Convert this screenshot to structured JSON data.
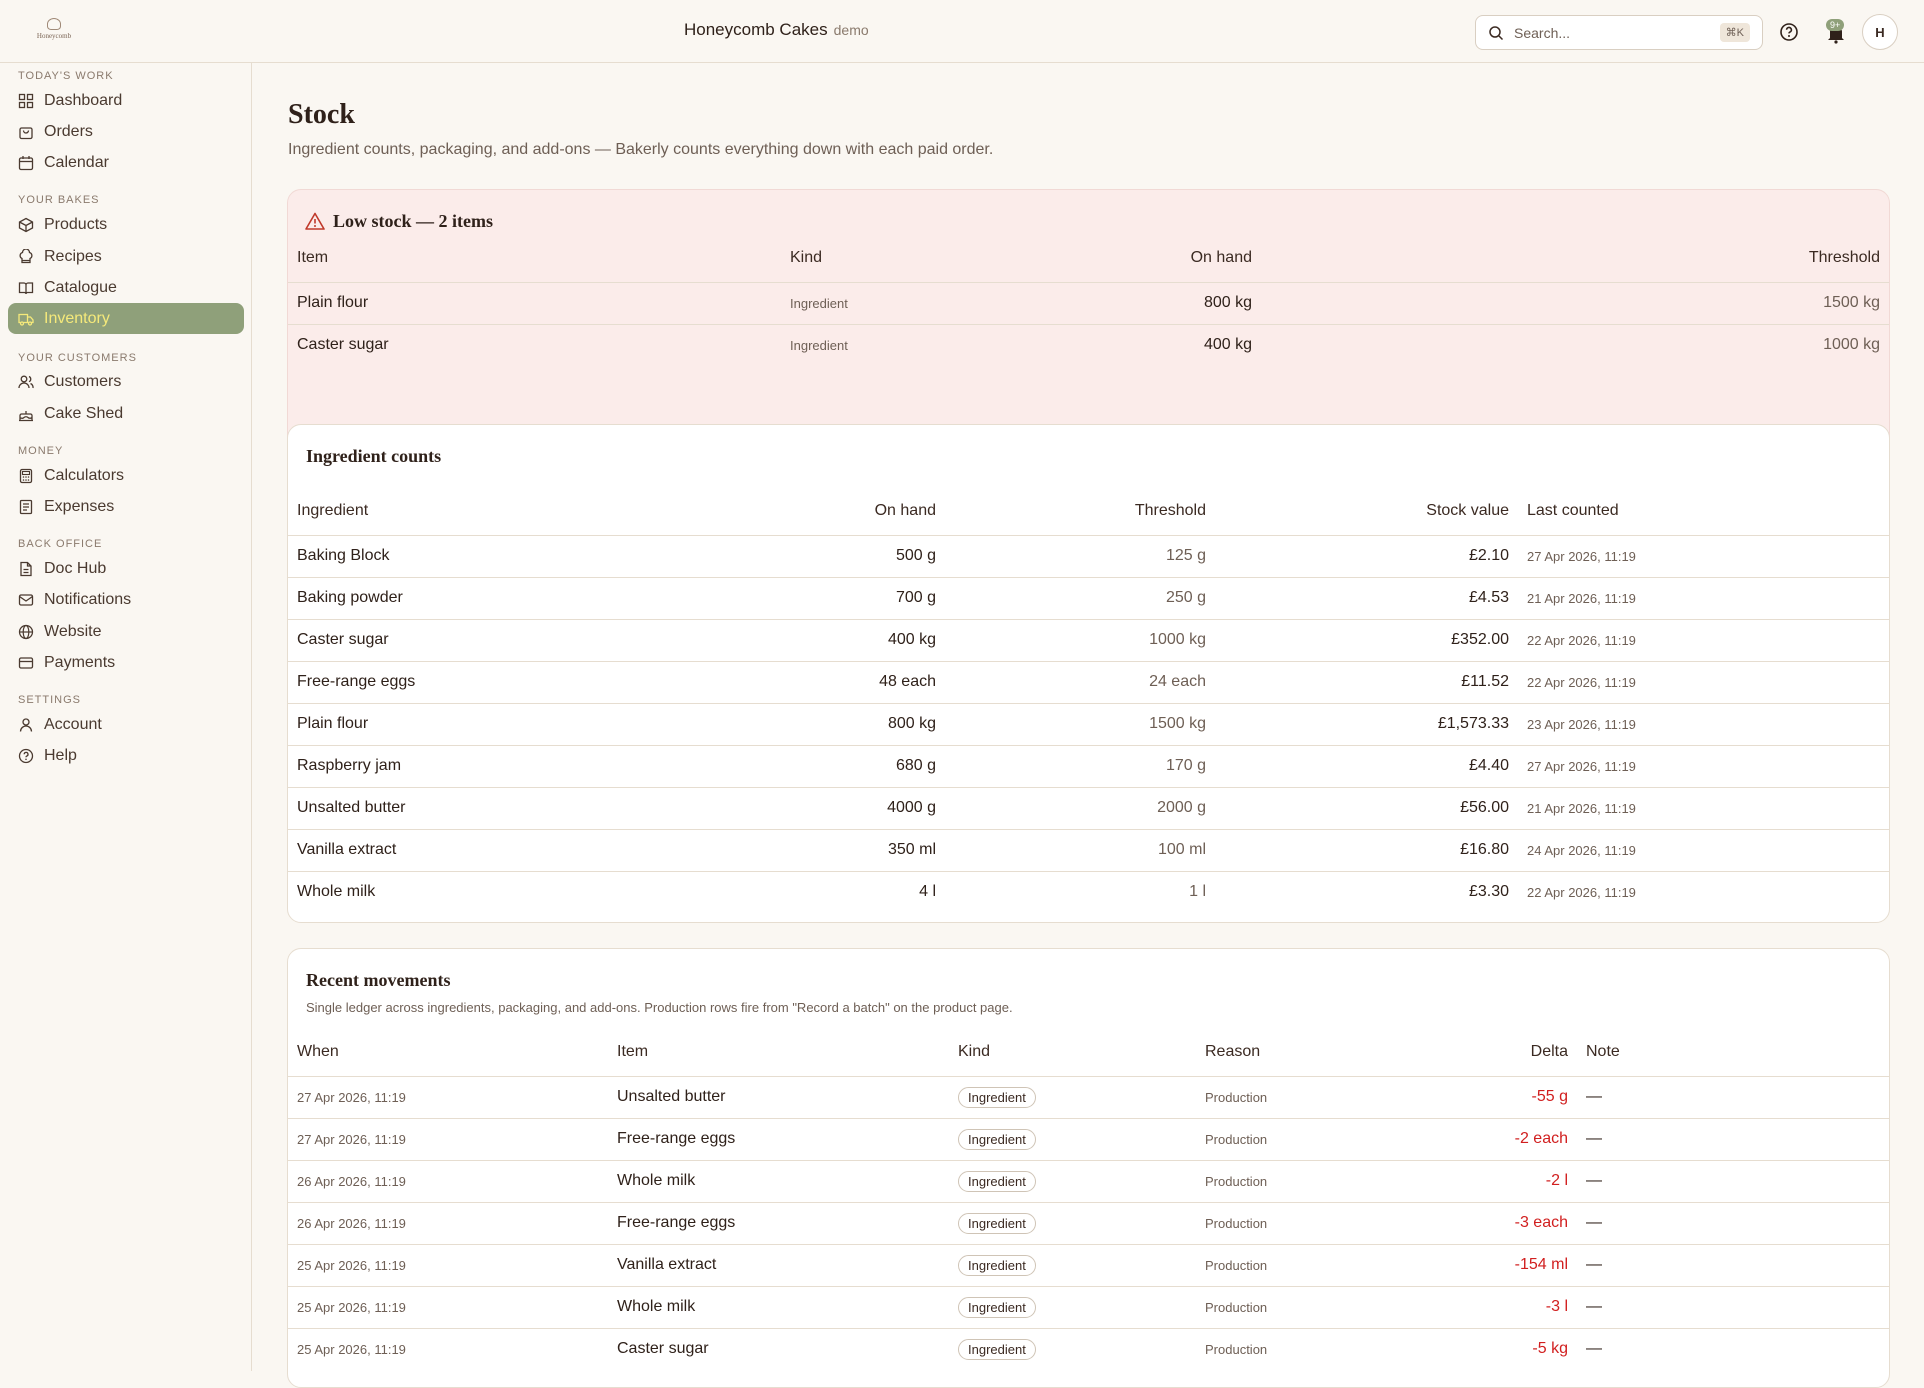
{
  "app": {
    "brand": "Honeycomb Cakes",
    "env": "demo",
    "logo_text": "Honeycomb"
  },
  "topbar": {
    "search_placeholder": "Search...",
    "search_shortcut": "⌘K",
    "notif_badge": "9+",
    "avatar_initial": "H"
  },
  "sidebar": {
    "sections": [
      {
        "label": "TODAY'S WORK",
        "items": [
          {
            "label": "Dashboard",
            "icon": "grid-icon"
          },
          {
            "label": "Orders",
            "icon": "bag-icon"
          },
          {
            "label": "Calendar",
            "icon": "calendar-icon"
          }
        ]
      },
      {
        "label": "YOUR BAKES",
        "items": [
          {
            "label": "Products",
            "icon": "box-icon"
          },
          {
            "label": "Recipes",
            "icon": "chef-hat-icon"
          },
          {
            "label": "Catalogue",
            "icon": "book-icon"
          },
          {
            "label": "Inventory",
            "icon": "truck-icon",
            "active": true
          }
        ]
      },
      {
        "label": "YOUR CUSTOMERS",
        "items": [
          {
            "label": "Customers",
            "icon": "users-icon"
          },
          {
            "label": "Cake Shed",
            "icon": "cake-icon"
          }
        ]
      },
      {
        "label": "MONEY",
        "items": [
          {
            "label": "Calculators",
            "icon": "calculator-icon"
          },
          {
            "label": "Expenses",
            "icon": "receipt-icon"
          }
        ]
      },
      {
        "label": "BACK OFFICE",
        "items": [
          {
            "label": "Doc Hub",
            "icon": "document-icon"
          },
          {
            "label": "Notifications",
            "icon": "mail-icon"
          },
          {
            "label": "Website",
            "icon": "globe-icon"
          },
          {
            "label": "Payments",
            "icon": "card-icon"
          }
        ]
      },
      {
        "label": "SETTINGS",
        "items": [
          {
            "label": "Account",
            "icon": "user-icon"
          },
          {
            "label": "Help",
            "icon": "help-icon"
          }
        ]
      }
    ]
  },
  "page": {
    "title": "Stock",
    "subtitle": "Ingredient counts, packaging, and add-ons — Bakerly counts everything down with each paid order."
  },
  "low_stock": {
    "title": "Low stock — 2 items",
    "columns": [
      "Item",
      "Kind",
      "On hand",
      "Threshold"
    ],
    "rows": [
      {
        "item": "Plain flour",
        "kind": "Ingredient",
        "on_hand": "800 kg",
        "threshold": "1500 kg"
      },
      {
        "item": "Caster sugar",
        "kind": "Ingredient",
        "on_hand": "400 kg",
        "threshold": "1000 kg"
      }
    ]
  },
  "ingredients": {
    "title": "Ingredient counts",
    "columns": [
      "Ingredient",
      "On hand",
      "Threshold",
      "Stock value",
      "Last counted"
    ],
    "rows": [
      {
        "name": "Baking Block",
        "on_hand": "500 g",
        "threshold": "125 g",
        "value": "£2.10",
        "last": "27 Apr 2026, 11:19"
      },
      {
        "name": "Baking powder",
        "on_hand": "700 g",
        "threshold": "250 g",
        "value": "£4.53",
        "last": "21 Apr 2026, 11:19"
      },
      {
        "name": "Caster sugar",
        "on_hand": "400 kg",
        "threshold": "1000 kg",
        "value": "£352.00",
        "last": "22 Apr 2026, 11:19"
      },
      {
        "name": "Free-range eggs",
        "on_hand": "48 each",
        "threshold": "24 each",
        "value": "£11.52",
        "last": "22 Apr 2026, 11:19"
      },
      {
        "name": "Plain flour",
        "on_hand": "800 kg",
        "threshold": "1500 kg",
        "value": "£1,573.33",
        "last": "23 Apr 2026, 11:19"
      },
      {
        "name": "Raspberry jam",
        "on_hand": "680 g",
        "threshold": "170 g",
        "value": "£4.40",
        "last": "27 Apr 2026, 11:19"
      },
      {
        "name": "Unsalted butter",
        "on_hand": "4000 g",
        "threshold": "2000 g",
        "value": "£56.00",
        "last": "21 Apr 2026, 11:19"
      },
      {
        "name": "Vanilla extract",
        "on_hand": "350 ml",
        "threshold": "100 ml",
        "value": "£16.80",
        "last": "24 Apr 2026, 11:19"
      },
      {
        "name": "Whole milk",
        "on_hand": "4 l",
        "threshold": "1 l",
        "value": "£3.30",
        "last": "22 Apr 2026, 11:19"
      }
    ]
  },
  "movements": {
    "title": "Recent movements",
    "subtitle": "Single ledger across ingredients, packaging, and add-ons. Production rows fire from \"Record a batch\" on the product page.",
    "columns": [
      "When",
      "Item",
      "Kind",
      "Reason",
      "Delta",
      "Note"
    ],
    "rows": [
      {
        "when": "27 Apr 2026, 11:19",
        "item": "Unsalted butter",
        "kind": "Ingredient",
        "reason": "Production",
        "delta": "-55 g",
        "note": "—"
      },
      {
        "when": "27 Apr 2026, 11:19",
        "item": "Free-range eggs",
        "kind": "Ingredient",
        "reason": "Production",
        "delta": "-2 each",
        "note": "—"
      },
      {
        "when": "26 Apr 2026, 11:19",
        "item": "Whole milk",
        "kind": "Ingredient",
        "reason": "Production",
        "delta": "-2 l",
        "note": "—"
      },
      {
        "when": "26 Apr 2026, 11:19",
        "item": "Free-range eggs",
        "kind": "Ingredient",
        "reason": "Production",
        "delta": "-3 each",
        "note": "—"
      },
      {
        "when": "25 Apr 2026, 11:19",
        "item": "Vanilla extract",
        "kind": "Ingredient",
        "reason": "Production",
        "delta": "-154 ml",
        "note": "—"
      },
      {
        "when": "25 Apr 2026, 11:19",
        "item": "Whole milk",
        "kind": "Ingredient",
        "reason": "Production",
        "delta": "-3 l",
        "note": "—"
      },
      {
        "when": "25 Apr 2026, 11:19",
        "item": "Caster sugar",
        "kind": "Ingredient",
        "reason": "Production",
        "delta": "-5 kg",
        "note": "—"
      }
    ]
  },
  "colors": {
    "accent": "#8fa07a",
    "active_text": "#f5e97a",
    "danger": "#d11f1f",
    "low_bg": "#fbecea"
  }
}
